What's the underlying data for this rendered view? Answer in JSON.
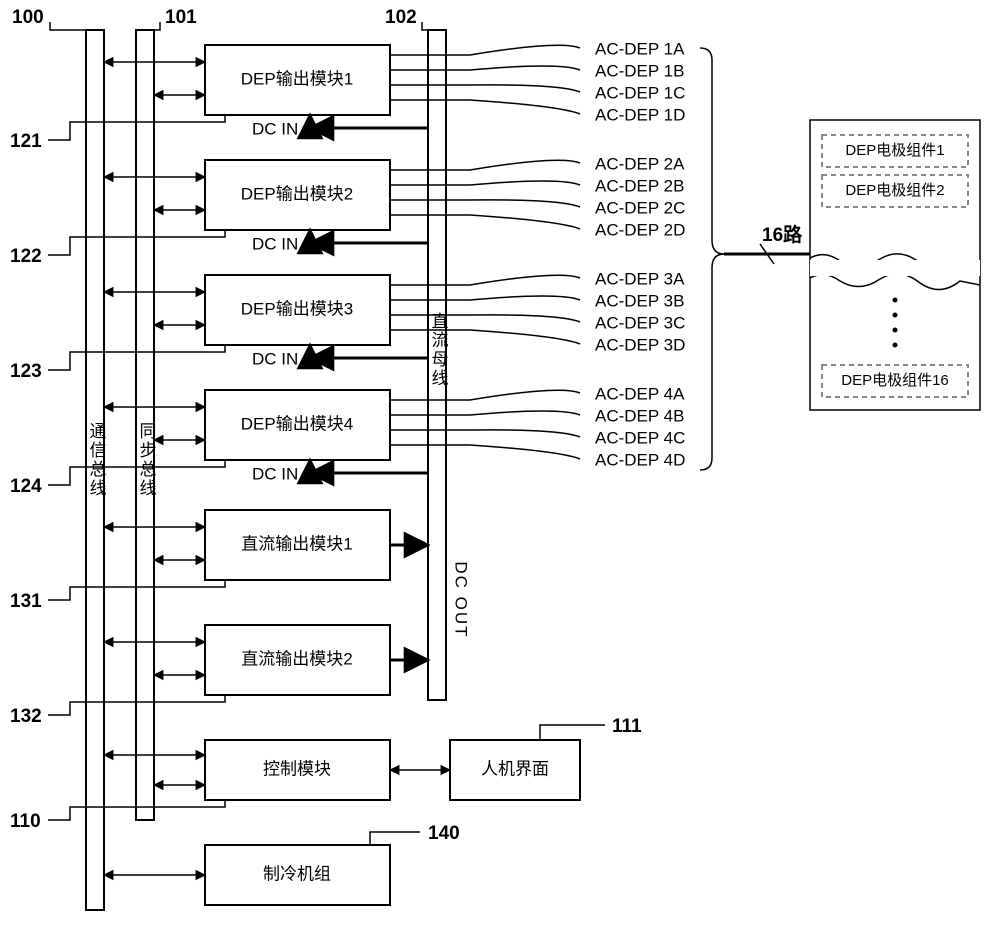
{
  "refs": {
    "r100": "100",
    "r101": "101",
    "r102": "102",
    "r121": "121",
    "r122": "122",
    "r123": "123",
    "r124": "124",
    "r131": "131",
    "r132": "132",
    "r110": "110",
    "r111": "111",
    "r140": "140"
  },
  "buses": {
    "b100": "通信总线",
    "b101": "同步总线",
    "b102": "直流母线"
  },
  "modules": {
    "dep1": "DEP输出模块1",
    "dep2": "DEP输出模块2",
    "dep3": "DEP输出模块3",
    "dep4": "DEP输出模块4",
    "dc1": "直流输出模块1",
    "dc2": "直流输出模块2",
    "ctrl": "控制模块",
    "hmi": "人机界面",
    "fridge": "制冷机组"
  },
  "labels": {
    "dcin": "DC IN",
    "dcout": "DC OUT",
    "routes": "16路"
  },
  "ac": {
    "a1": "AC-DEP 1A",
    "a2": "AC-DEP 1B",
    "a3": "AC-DEP 1C",
    "a4": "AC-DEP 1D",
    "b1": "AC-DEP 2A",
    "b2": "AC-DEP 2B",
    "b3": "AC-DEP 2C",
    "b4": "AC-DEP 2D",
    "c1": "AC-DEP 3A",
    "c2": "AC-DEP 3B",
    "c3": "AC-DEP 3C",
    "c4": "AC-DEP 3D",
    "d1": "AC-DEP 4A",
    "d2": "AC-DEP 4B",
    "d3": "AC-DEP 4C",
    "d4": "AC-DEP 4D"
  },
  "dep_elec": {
    "e1": "DEP电极组件1",
    "e2": "DEP电极组件2",
    "e16": "DEP电极组件16"
  },
  "chart_data": {
    "type": "diagram",
    "description": "Block diagram of DEP power supply system",
    "buses": [
      {
        "id": 100,
        "name": "通信总线"
      },
      {
        "id": 101,
        "name": "同步总线"
      },
      {
        "id": 102,
        "name": "直流母线"
      }
    ],
    "modules": [
      {
        "id": 121,
        "name": "DEP输出模块1",
        "connects": [
          "100",
          "101",
          "102(DC IN)"
        ],
        "outputs": [
          "AC-DEP 1A",
          "AC-DEP 1B",
          "AC-DEP 1C",
          "AC-DEP 1D"
        ]
      },
      {
        "id": 122,
        "name": "DEP输出模块2",
        "connects": [
          "100",
          "101",
          "102(DC IN)"
        ],
        "outputs": [
          "AC-DEP 2A",
          "AC-DEP 2B",
          "AC-DEP 2C",
          "AC-DEP 2D"
        ]
      },
      {
        "id": 123,
        "name": "DEP输出模块3",
        "connects": [
          "100",
          "101",
          "102(DC IN)"
        ],
        "outputs": [
          "AC-DEP 3A",
          "AC-DEP 3B",
          "AC-DEP 3C",
          "AC-DEP 3D"
        ]
      },
      {
        "id": 124,
        "name": "DEP输出模块4",
        "connects": [
          "100",
          "101",
          "102(DC IN)"
        ],
        "outputs": [
          "AC-DEP 4A",
          "AC-DEP 4B",
          "AC-DEP 4C",
          "AC-DEP 4D"
        ]
      },
      {
        "id": 131,
        "name": "直流输出模块1",
        "connects": [
          "100",
          "101"
        ],
        "outputs": [
          "102(DC OUT)"
        ]
      },
      {
        "id": 132,
        "name": "直流输出模块2",
        "connects": [
          "100",
          "101"
        ],
        "outputs": [
          "102(DC OUT)"
        ]
      },
      {
        "id": 110,
        "name": "控制模块",
        "connects": [
          "100",
          "101",
          "人机界面(111)"
        ]
      },
      {
        "id": 140,
        "name": "制冷机组",
        "connects": [
          "100"
        ]
      }
    ],
    "right_block": {
      "channels": 16,
      "items": [
        "DEP电极组件1",
        "DEP电极组件2",
        "...",
        "DEP电极组件16"
      ]
    }
  }
}
